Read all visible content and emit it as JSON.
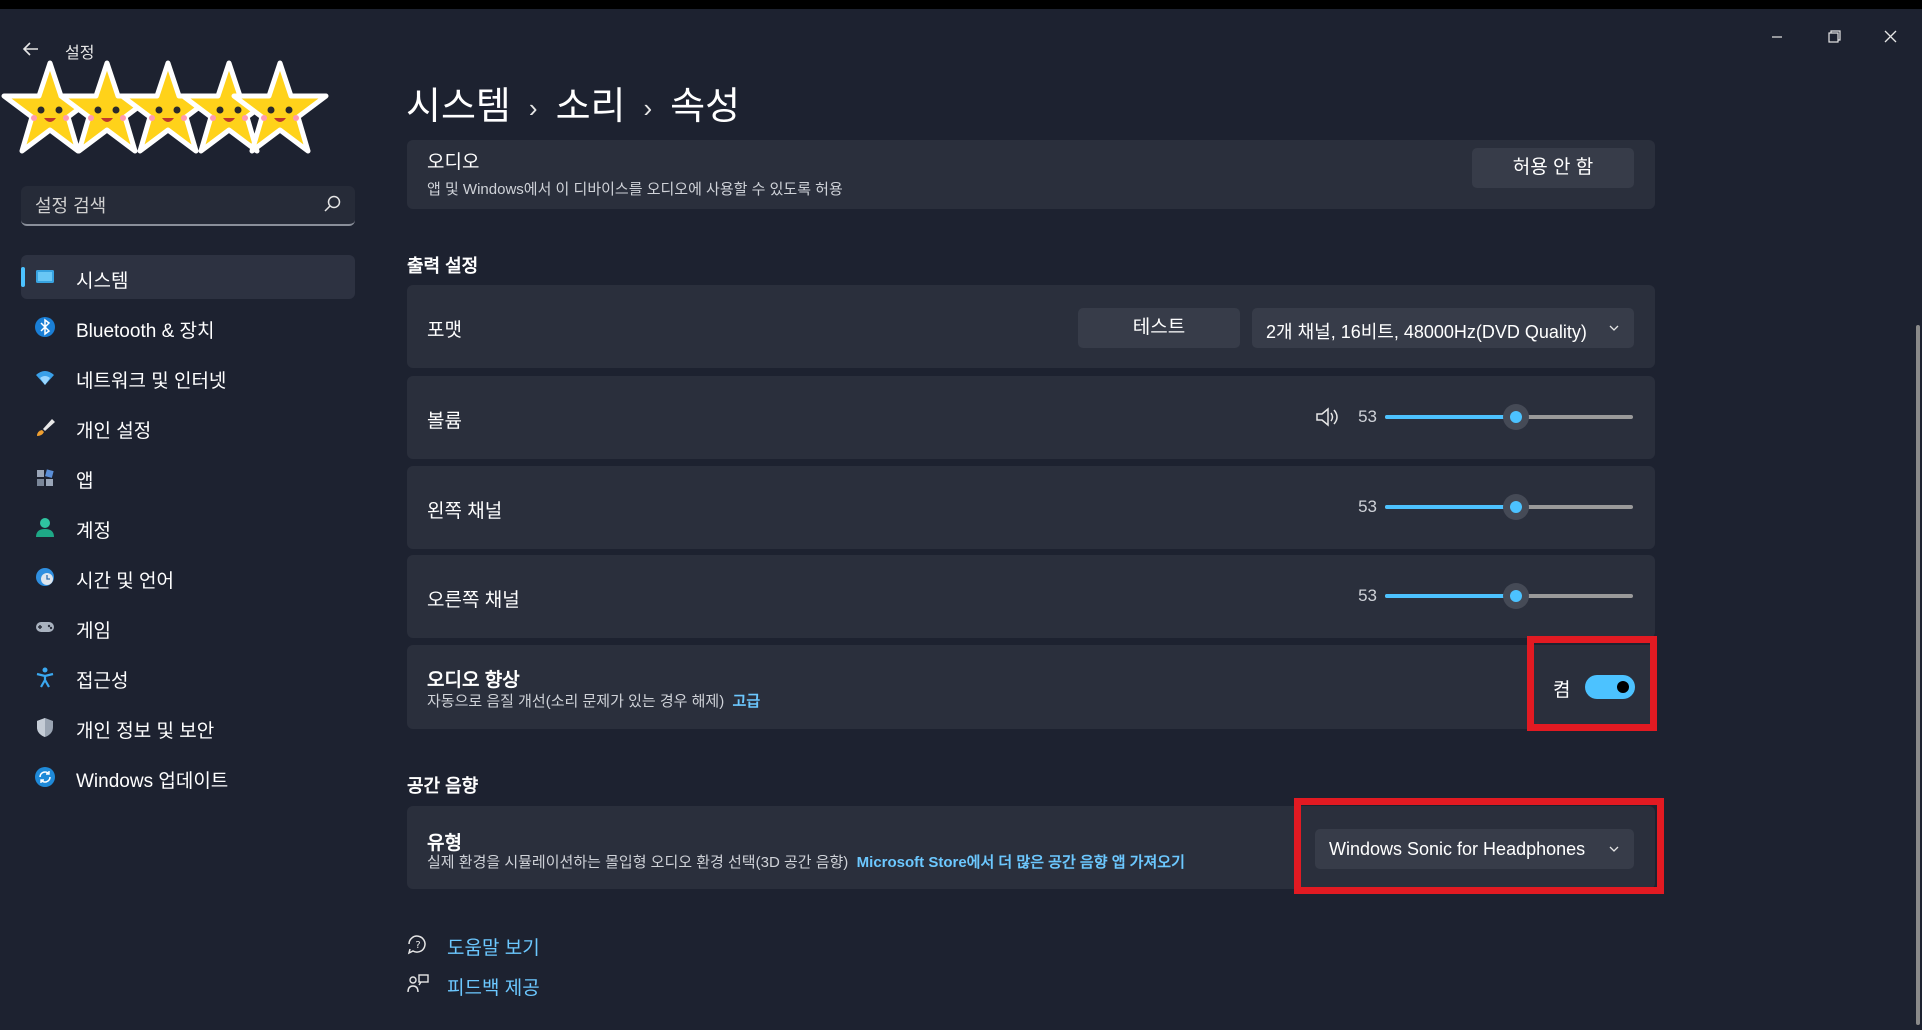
{
  "app": {
    "title": "설정"
  },
  "search": {
    "placeholder": "설정 검색"
  },
  "sidebar": {
    "items": [
      {
        "label": "시스템",
        "icon": "monitor-icon",
        "selected": true
      },
      {
        "label": "Bluetooth & 장치",
        "icon": "bluetooth-icon"
      },
      {
        "label": "네트워크 및 인터넷",
        "icon": "wifi-icon"
      },
      {
        "label": "개인 설정",
        "icon": "brush-icon"
      },
      {
        "label": "앱",
        "icon": "apps-icon"
      },
      {
        "label": "계정",
        "icon": "account-icon"
      },
      {
        "label": "시간 및 언어",
        "icon": "globe-clock-icon"
      },
      {
        "label": "게임",
        "icon": "gamepad-icon"
      },
      {
        "label": "접근성",
        "icon": "accessibility-icon"
      },
      {
        "label": "개인 정보 및 보안",
        "icon": "shield-icon"
      },
      {
        "label": "Windows 업데이트",
        "icon": "update-icon"
      }
    ]
  },
  "breadcrumb": {
    "level1": "시스템",
    "level2": "소리",
    "level3": "속성",
    "separator": "›"
  },
  "audio": {
    "label": "오디오",
    "desc": "앱 및 Windows에서 이 디바이스를 오디오에 사용할 수 있도록 허용",
    "button": "허용 안 함"
  },
  "output": {
    "section_title": "출력 설정",
    "format": {
      "label": "포맷",
      "test_button": "테스트",
      "selected": "2개 채널, 16비트, 48000Hz(DVD Quality)"
    },
    "volume": {
      "label": "볼륨",
      "value": "53",
      "level": 0.53
    },
    "left": {
      "label": "왼쪽 채널",
      "value": "53",
      "level": 0.53
    },
    "right": {
      "label": "오른쪽 채널",
      "value": "53",
      "level": 0.53
    },
    "enhance": {
      "label": "오디오 향상",
      "desc": "자동으로 음질 개선(소리 문제가 있는 경우 해제)",
      "link": "고급",
      "toggle_label": "켬",
      "on": true
    }
  },
  "spatial": {
    "section_title": "공간 음향",
    "type": {
      "label": "유형",
      "desc": "실제 환경을 시뮬레이션하는 몰입형 오디오 환경 선택(3D 공간 음향)",
      "link": "Microsoft Store에서 더 많은 공간 음향 앱 가져오기",
      "selected": "Windows Sonic for Headphones"
    }
  },
  "links": {
    "help": "도움말 보기",
    "feedback": "피드백 제공"
  },
  "rating": {
    "stars": 5
  },
  "colors": {
    "accent": "#4cc2ff",
    "highlight": "#e21a22",
    "background": "#1d2230",
    "card": "#2a2f3c"
  }
}
